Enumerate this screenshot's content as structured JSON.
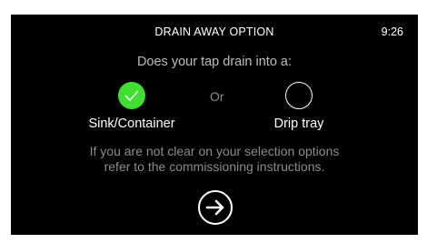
{
  "header": {
    "title": "DRAIN AWAY OPTION",
    "time": "9:26"
  },
  "question": "Does your tap drain into a:",
  "options": [
    {
      "label": "Sink/Container",
      "selected": true
    },
    {
      "label": "Drip tray",
      "selected": false
    }
  ],
  "separator": "Or",
  "info": {
    "line1": "If you are not clear on your selection options",
    "line2": "refer to the commissioning instructions."
  },
  "next_button": {
    "icon": "arrow-right-icon"
  },
  "colors": {
    "background": "#000000",
    "accent": "#3fe02f",
    "text": "#ffffff",
    "muted_text": "#8c8c8c",
    "question_text": "#bdbdbd"
  }
}
